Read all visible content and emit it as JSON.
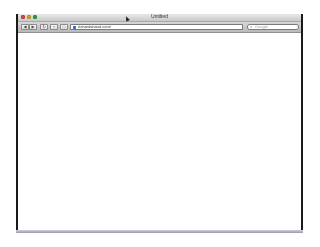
{
  "window": {
    "title": "Untitled"
  },
  "toolbar": {
    "back_label": "◀",
    "forward_label": "▶",
    "reload_label": "↻",
    "add_label": "+",
    "bookmarks_label": "□",
    "address_value": "richardshand.com/",
    "search_placeholder": "Google",
    "search_icon": "⌕"
  },
  "colors": {
    "close": "#e0443e",
    "minimize": "#dea123",
    "maximize": "#1aab29"
  }
}
